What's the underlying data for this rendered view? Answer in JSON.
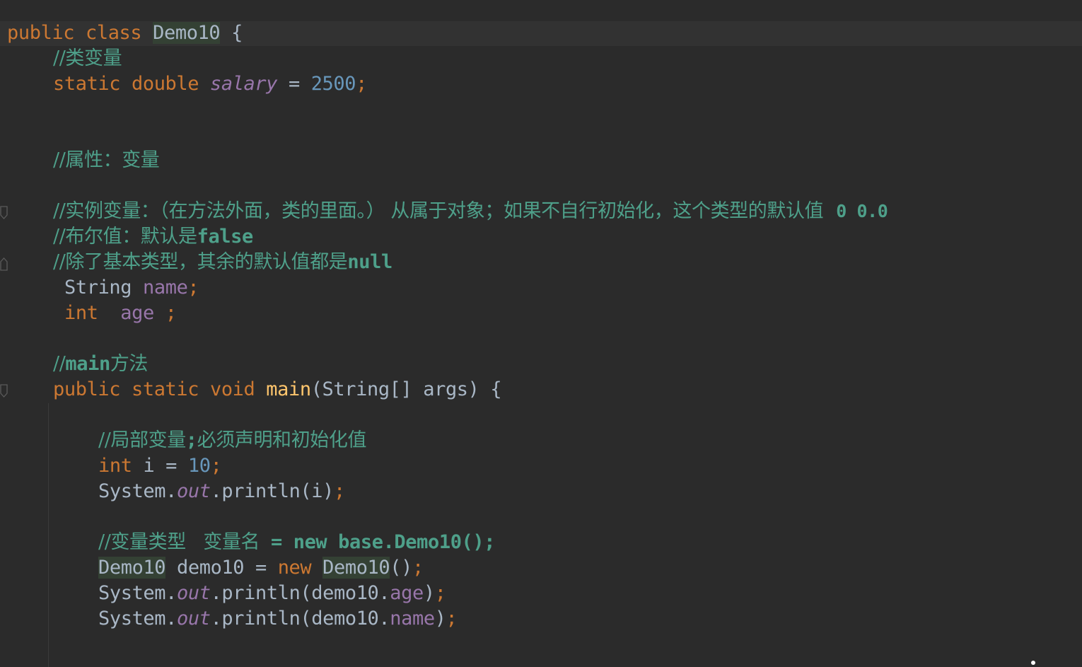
{
  "line1": {
    "kw": "public class",
    "cls": "Demo10",
    "brace": "{"
  },
  "line2": {
    "comment": "//类变量"
  },
  "line3": {
    "kw": "static double",
    "field": "salary",
    "eq": "=",
    "value": "2500",
    "semi": ";"
  },
  "line6": {
    "comment": "//属性：变量"
  },
  "line8": {
    "comment": "//实例变量：（在方法外面，类的里面。） 从属于对象；如果不自行初始化，这个类型的默认值",
    "tail": "0 0.0"
  },
  "line9": {
    "comment": "//布尔值：默认是",
    "tail": "false"
  },
  "line10": {
    "comment": "//除了基本类型，其余的默认值都是",
    "tail": "null"
  },
  "line11": {
    "type": "String",
    "field": "name",
    "semi": ";"
  },
  "line12": {
    "kw": "int",
    "field": "age",
    "semi": ";"
  },
  "line14": {
    "comment_pre": "//",
    "comment_bold": "main",
    "comment_post": "方法"
  },
  "line15": {
    "kw": "public static void",
    "method": "main",
    "params": "(String[] args) {"
  },
  "line17": {
    "comment_pre": "//局部变量",
    "comment_bold": ";",
    "comment_post": "必须声明和初始化值"
  },
  "line18": {
    "kw": "int",
    "var": "i =",
    "value": "10",
    "semi": ";"
  },
  "line19": {
    "sys": "System.",
    "out": "out",
    "call": ".println(i)",
    "semi": ";"
  },
  "line21": {
    "comment": "//变量类型   变量名",
    "tail": " = new base.Demo10();"
  },
  "line22": {
    "cls": "Demo10",
    "var": "demo10 =",
    "kw": "new",
    "cls2": "Demo10",
    "call": "()",
    "semi": ";"
  },
  "line23": {
    "sys": "System.",
    "out": "out",
    "call_pre": ".println(demo10.",
    "field": "age",
    "call_post": ")",
    "semi": ";"
  },
  "line24": {
    "sys": "System.",
    "out": "out",
    "call_pre": ".println(demo10.",
    "field": "name",
    "call_post": ")",
    "semi": ";"
  },
  "colors": {
    "background": "#2b2b2b",
    "keyword": "#cc7832",
    "number": "#6897bb",
    "field": "#9876aa",
    "method": "#ffc66d",
    "comment": "#4ea08a",
    "text": "#a9b7c6"
  }
}
